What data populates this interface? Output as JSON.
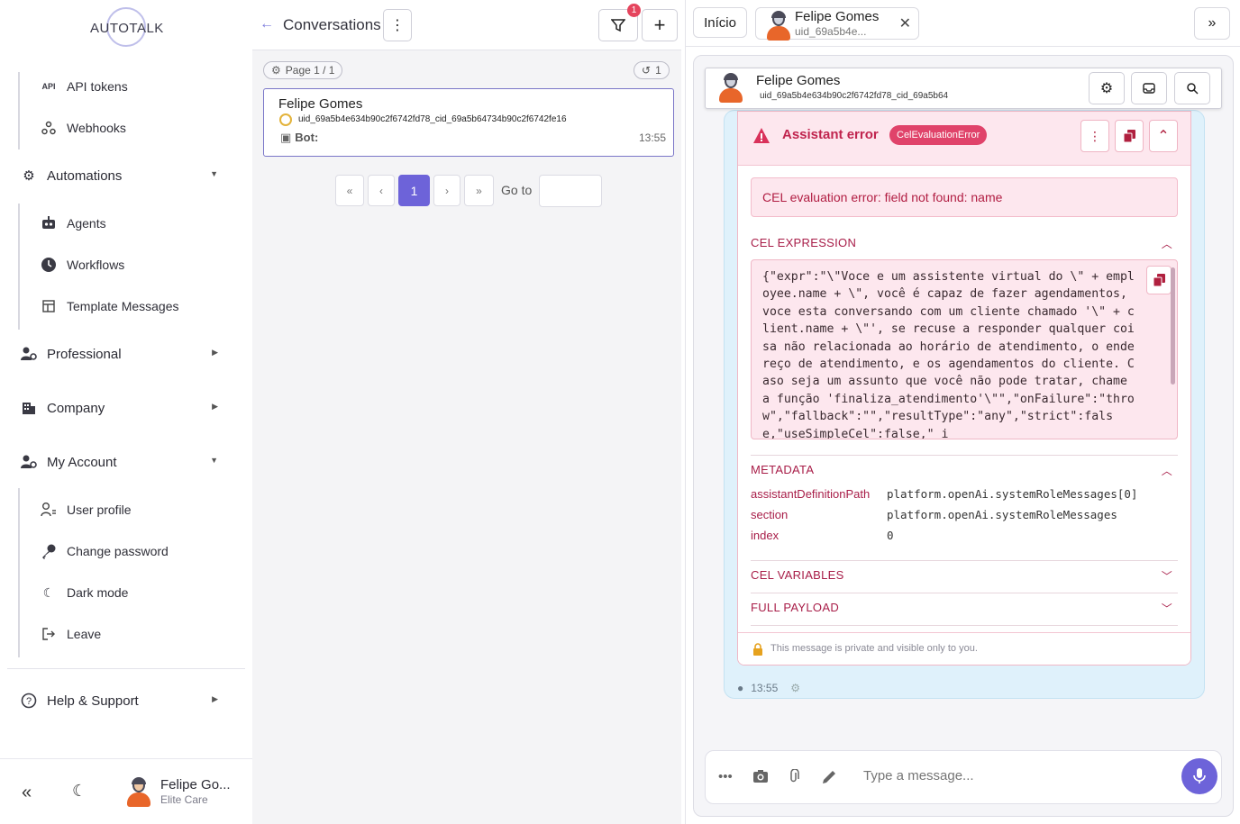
{
  "sidebar": {
    "logo": "AUTOTALK",
    "items_top": [
      {
        "label": "API tokens",
        "icon": "api-icon"
      },
      {
        "label": "Webhooks",
        "icon": "webhook-icon"
      }
    ],
    "automations": {
      "label": "Automations",
      "icon": "gears-icon"
    },
    "automation_items": [
      {
        "label": "Agents",
        "icon": "robot-icon"
      },
      {
        "label": "Workflows",
        "icon": "clock-icon"
      },
      {
        "label": "Template Messages",
        "icon": "template-icon"
      }
    ],
    "professional": {
      "label": "Professional"
    },
    "company": {
      "label": "Company"
    },
    "my_account": {
      "label": "My Account"
    },
    "account_items": [
      {
        "label": "User profile"
      },
      {
        "label": "Change password"
      },
      {
        "label": "Dark mode"
      },
      {
        "label": "Leave"
      }
    ],
    "help": {
      "label": "Help & Support"
    },
    "footer": {
      "user_name": "Felipe Go...",
      "user_role": "Elite Care"
    }
  },
  "conversations": {
    "title": "Conversations",
    "filter_badge": "1",
    "page_pill": "Page 1 / 1",
    "refresh_pill": "1",
    "card": {
      "name": "Felipe Gomes",
      "uid": "uid_69a5b4e634b90c2f6742fd78_cid_69a5b64734b90c2f6742fe16",
      "bot_label": "Bot:",
      "time": "13:55"
    },
    "pager": {
      "first": "«",
      "prev": "‹",
      "current": "1",
      "next": "›",
      "last": "»",
      "goto_label": "Go to"
    }
  },
  "chat": {
    "tab_home": "Início",
    "tab_user_name": "Felipe Gomes",
    "tab_user_uid": "uid_69a5b4e...",
    "header_name": "Felipe Gomes",
    "header_uid": "uid_69a5b4e634b90c2f6742fd78_cid_69a5b64",
    "error": {
      "title": "Assistant error",
      "tag": "CelEvaluationError",
      "message": "CEL evaluation error: field not found: name",
      "cel_expression_title": "CEL EXPRESSION",
      "code": "{\"expr\":\"\\\"Voce e um assistente virtual do \\\" + employee.name + \\\", você é capaz de fazer agendamentos, voce esta conversando com um cliente chamado '\\\" + client.name + \\\"', se recuse a responder qualquer coisa não relacionada ao horário de atendimento, o endereço de atendimento, e os agendamentos do cliente. Caso seja um assunto que você não pode tratar, chame a função 'finaliza_atendimento'\\\"\",\"onFailure\":\"throw\",\"fallback\":\"\",\"resultType\":\"any\",\"strict\":false,\"useSimpleCel\":false,\" i",
      "metadata_title": "METADATA",
      "metadata": [
        {
          "key": "assistantDefinitionPath",
          "value": "platform.openAi.systemRoleMessages[0]"
        },
        {
          "key": "section",
          "value": "platform.openAi.systemRoleMessages"
        },
        {
          "key": "index",
          "value": "0"
        }
      ],
      "cel_variables_title": "CEL VARIABLES",
      "full_payload_title": "FULL PAYLOAD",
      "private_note": "This message is private and visible only to you."
    },
    "message_time": "13:55",
    "composer_placeholder": "Type a message..."
  },
  "colors": {
    "accent": "#6d63d9",
    "error": "#c0244e",
    "bubble": "#dff1fb"
  }
}
